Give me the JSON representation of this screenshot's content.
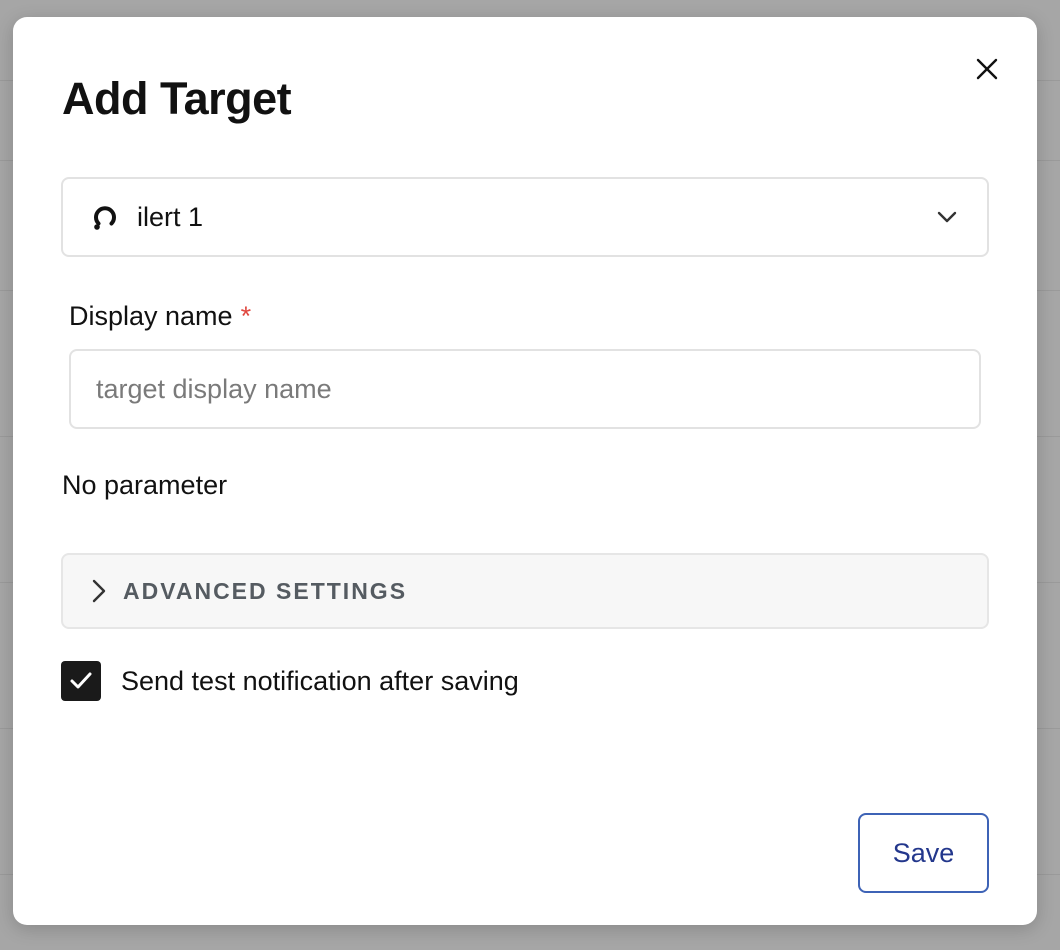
{
  "modal": {
    "title": "Add Target",
    "close_icon": "close-icon"
  },
  "connector_select": {
    "icon": "ilert-logo-icon",
    "selected_value": "ilert 1",
    "chevron_icon": "chevron-down-icon"
  },
  "display_name": {
    "label": "Display name",
    "required_marker": "*",
    "value": "",
    "placeholder": "target display name"
  },
  "parameters": {
    "text": "No parameter"
  },
  "advanced_settings": {
    "label": "ADVANCED SETTINGS",
    "chevron_icon": "chevron-right-icon",
    "expanded": false
  },
  "test_notification": {
    "label": "Send test notification after saving",
    "checked": true
  },
  "actions": {
    "save_label": "Save"
  },
  "colors": {
    "primary_button_border": "#3e63b6",
    "primary_button_text": "#23378c",
    "required": "#e0473f",
    "checkbox": "#1a1a1a",
    "backdrop": "#a6a6a6"
  }
}
